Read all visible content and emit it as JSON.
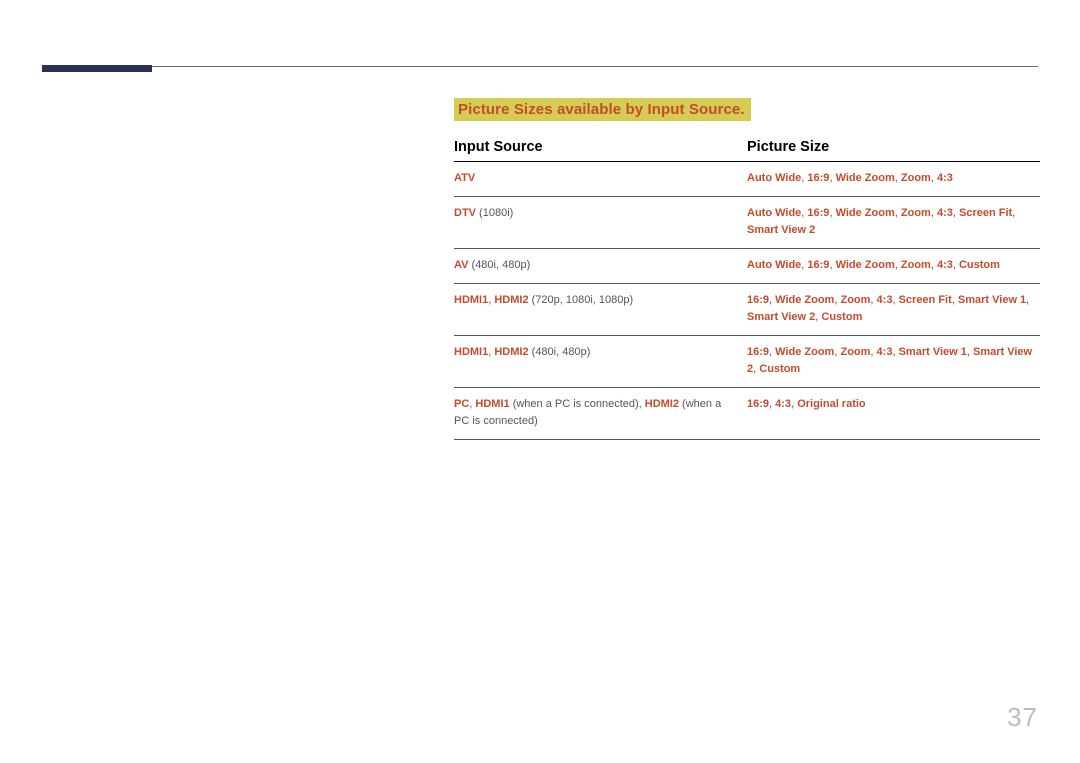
{
  "sectionTitle": "Picture Sizes available by Input Source.",
  "headers": {
    "inputSource": "Input Source",
    "pictureSize": "Picture Size"
  },
  "rows": [
    {
      "source": [
        {
          "text": "ATV",
          "hl": true
        }
      ],
      "size": [
        {
          "text": "Auto Wide",
          "hl": true
        },
        {
          "text": ", ",
          "hl": false
        },
        {
          "text": "16:9",
          "hl": true
        },
        {
          "text": ", ",
          "hl": false
        },
        {
          "text": "Wide Zoom",
          "hl": true
        },
        {
          "text": ", ",
          "hl": false
        },
        {
          "text": "Zoom",
          "hl": true
        },
        {
          "text": ", ",
          "hl": false
        },
        {
          "text": "4:3",
          "hl": true
        }
      ]
    },
    {
      "source": [
        {
          "text": "DTV",
          "hl": true
        },
        {
          "text": " (1080i)",
          "hl": false
        }
      ],
      "size": [
        {
          "text": "Auto Wide",
          "hl": true
        },
        {
          "text": ", ",
          "hl": false
        },
        {
          "text": "16:9",
          "hl": true
        },
        {
          "text": ", ",
          "hl": false
        },
        {
          "text": "Wide Zoom",
          "hl": true
        },
        {
          "text": ", ",
          "hl": false
        },
        {
          "text": "Zoom",
          "hl": true
        },
        {
          "text": ", ",
          "hl": false
        },
        {
          "text": "4:3",
          "hl": true
        },
        {
          "text": ", ",
          "hl": false
        },
        {
          "text": "Screen Fit",
          "hl": true
        },
        {
          "text": ", ",
          "hl": false
        },
        {
          "text": "Smart View 2",
          "hl": true
        }
      ]
    },
    {
      "source": [
        {
          "text": "AV",
          "hl": true
        },
        {
          "text": " (480i, 480p)",
          "hl": false
        }
      ],
      "size": [
        {
          "text": "Auto Wide",
          "hl": true
        },
        {
          "text": ", ",
          "hl": false
        },
        {
          "text": "16:9",
          "hl": true
        },
        {
          "text": ", ",
          "hl": false
        },
        {
          "text": "Wide Zoom",
          "hl": true
        },
        {
          "text": ", ",
          "hl": false
        },
        {
          "text": "Zoom",
          "hl": true
        },
        {
          "text": ", ",
          "hl": false
        },
        {
          "text": "4:3",
          "hl": true
        },
        {
          "text": ", ",
          "hl": false
        },
        {
          "text": "Custom",
          "hl": true
        }
      ]
    },
    {
      "source": [
        {
          "text": "HDMI1",
          "hl": true
        },
        {
          "text": ", ",
          "hl": false
        },
        {
          "text": "HDMI2",
          "hl": true
        },
        {
          "text": " (720p, 1080i, 1080p)",
          "hl": false
        }
      ],
      "size": [
        {
          "text": "16:9",
          "hl": true
        },
        {
          "text": ", ",
          "hl": false
        },
        {
          "text": "Wide Zoom",
          "hl": true
        },
        {
          "text": ", ",
          "hl": false
        },
        {
          "text": "Zoom",
          "hl": true
        },
        {
          "text": ", ",
          "hl": false
        },
        {
          "text": "4:3",
          "hl": true
        },
        {
          "text": ", ",
          "hl": false
        },
        {
          "text": "Screen Fit",
          "hl": true
        },
        {
          "text": ", ",
          "hl": false
        },
        {
          "text": "Smart View 1",
          "hl": true
        },
        {
          "text": ", ",
          "hl": false
        },
        {
          "text": "Smart View 2",
          "hl": true
        },
        {
          "text": ", ",
          "hl": false
        },
        {
          "text": "Custom",
          "hl": true
        }
      ]
    },
    {
      "source": [
        {
          "text": "HDMI1",
          "hl": true
        },
        {
          "text": ", ",
          "hl": false
        },
        {
          "text": "HDMI2",
          "hl": true
        },
        {
          "text": " (480i, 480p)",
          "hl": false
        }
      ],
      "size": [
        {
          "text": "16:9",
          "hl": true
        },
        {
          "text": ", ",
          "hl": false
        },
        {
          "text": "Wide Zoom",
          "hl": true
        },
        {
          "text": ", ",
          "hl": false
        },
        {
          "text": "Zoom",
          "hl": true
        },
        {
          "text": ", ",
          "hl": false
        },
        {
          "text": "4:3",
          "hl": true
        },
        {
          "text": ", ",
          "hl": false
        },
        {
          "text": "Smart View 1",
          "hl": true
        },
        {
          "text": ", ",
          "hl": false
        },
        {
          "text": "Smart View 2",
          "hl": true
        },
        {
          "text": ", ",
          "hl": false
        },
        {
          "text": "Custom",
          "hl": true
        }
      ]
    },
    {
      "source": [
        {
          "text": "PC",
          "hl": true
        },
        {
          "text": ", ",
          "hl": false
        },
        {
          "text": "HDMI1",
          "hl": true
        },
        {
          "text": " (when a PC is connected), ",
          "hl": false
        },
        {
          "text": "HDMI2",
          "hl": true
        },
        {
          "text": " (when a PC is connected)",
          "hl": false
        }
      ],
      "size": [
        {
          "text": "16:9",
          "hl": true
        },
        {
          "text": ", ",
          "hl": false
        },
        {
          "text": "4:3",
          "hl": true
        },
        {
          "text": ", ",
          "hl": false
        },
        {
          "text": "Original ratio",
          "hl": true
        }
      ]
    }
  ],
  "pageNumber": "37"
}
